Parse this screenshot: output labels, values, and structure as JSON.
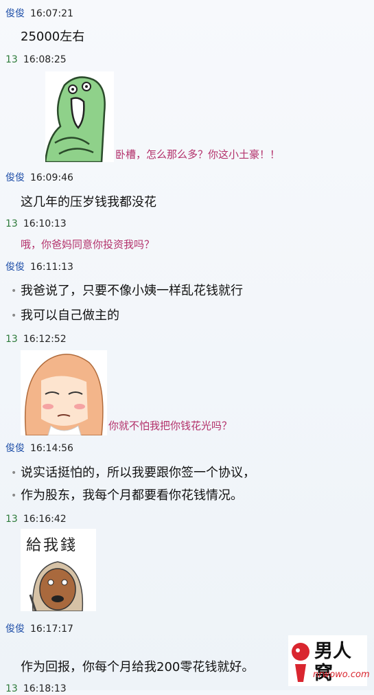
{
  "chat": [
    {
      "sender": "俊俊",
      "time": "16:07:21",
      "lines": [
        "25000左右"
      ]
    },
    {
      "sender": "13",
      "time": "16:08:25",
      "caption": "卧槽，怎么那么多？你这小土豪！！"
    },
    {
      "sender": "俊俊",
      "time": "16:09:46",
      "lines": [
        "这几年的压岁钱我都没花"
      ]
    },
    {
      "sender": "13",
      "time": "16:10:13",
      "caption": "哦，你爸妈同意你投资我吗？"
    },
    {
      "sender": "俊俊",
      "time": "16:11:13",
      "lines": [
        "我爸说了，只要不像小姨一样乱花钱就行",
        "我可以自己做主的"
      ]
    },
    {
      "sender": "13",
      "time": "16:12:52",
      "caption": "你就不怕我把你钱花光吗？"
    },
    {
      "sender": "俊俊",
      "time": "16:14:56",
      "lines": [
        "说实话挺怕的，所以我要跟你签一个协议，",
        "作为股东，我每个月都要看你花钱情况。"
      ]
    },
    {
      "sender": "13",
      "time": "16:16:42",
      "sticker_text": "給我錢"
    },
    {
      "sender": "俊俊",
      "time": "16:17:17",
      "lines": [
        "作为回报，你每个月给我200零花钱就好。"
      ]
    },
    {
      "sender": "13",
      "time": "16:18:13"
    }
  ],
  "watermark": {
    "title": "男人窝",
    "url": "nrwowo.com"
  }
}
